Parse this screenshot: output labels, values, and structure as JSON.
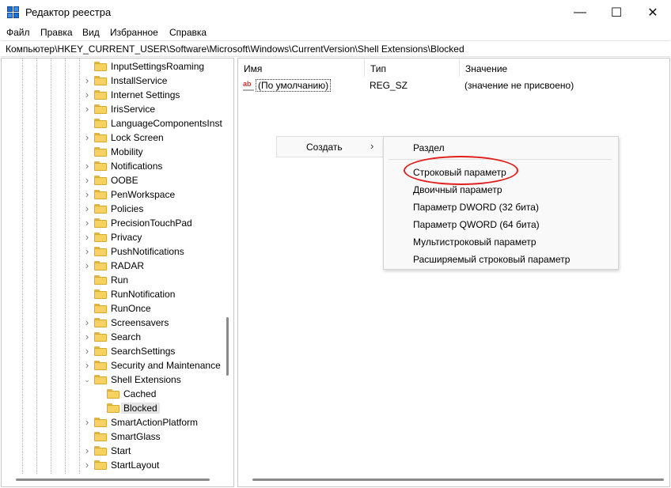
{
  "window": {
    "title": "Редактор реестра",
    "minimize_glyph": "—",
    "maximize_glyph": "☐",
    "close_glyph": "✕"
  },
  "menu": [
    "Файл",
    "Правка",
    "Вид",
    "Избранное",
    "Справка"
  ],
  "address": "Компьютер\\HKEY_CURRENT_USER\\Software\\Microsoft\\Windows\\CurrentVersion\\Shell Extensions\\Blocked",
  "tree": {
    "items": [
      {
        "label": "InputSettingsRoaming",
        "expander": "none",
        "level": 0
      },
      {
        "label": "InstallService",
        "expander": "collapsed",
        "level": 0
      },
      {
        "label": "Internet Settings",
        "expander": "collapsed",
        "level": 0
      },
      {
        "label": "IrisService",
        "expander": "collapsed",
        "level": 0
      },
      {
        "label": "LanguageComponentsInst",
        "expander": "none",
        "level": 0
      },
      {
        "label": "Lock Screen",
        "expander": "collapsed",
        "level": 0
      },
      {
        "label": "Mobility",
        "expander": "none",
        "level": 0
      },
      {
        "label": "Notifications",
        "expander": "collapsed",
        "level": 0
      },
      {
        "label": "OOBE",
        "expander": "collapsed",
        "level": 0
      },
      {
        "label": "PenWorkspace",
        "expander": "collapsed",
        "level": 0
      },
      {
        "label": "Policies",
        "expander": "collapsed",
        "level": 0
      },
      {
        "label": "PrecisionTouchPad",
        "expander": "collapsed",
        "level": 0
      },
      {
        "label": "Privacy",
        "expander": "collapsed",
        "level": 0
      },
      {
        "label": "PushNotifications",
        "expander": "collapsed",
        "level": 0
      },
      {
        "label": "RADAR",
        "expander": "collapsed",
        "level": 0
      },
      {
        "label": "Run",
        "expander": "none",
        "level": 0
      },
      {
        "label": "RunNotification",
        "expander": "none",
        "level": 0
      },
      {
        "label": "RunOnce",
        "expander": "none",
        "level": 0
      },
      {
        "label": "Screensavers",
        "expander": "collapsed",
        "level": 0
      },
      {
        "label": "Search",
        "expander": "collapsed",
        "level": 0
      },
      {
        "label": "SearchSettings",
        "expander": "collapsed",
        "level": 0
      },
      {
        "label": "Security and Maintenance",
        "expander": "collapsed",
        "level": 0
      },
      {
        "label": "Shell Extensions",
        "expander": "expanded",
        "level": 0
      },
      {
        "label": "Cached",
        "expander": "none",
        "level": 1
      },
      {
        "label": "Blocked",
        "expander": "none",
        "level": 1,
        "selected": true
      },
      {
        "label": "SmartActionPlatform",
        "expander": "collapsed",
        "level": 0
      },
      {
        "label": "SmartGlass",
        "expander": "none",
        "level": 0
      },
      {
        "label": "Start",
        "expander": "collapsed",
        "level": 0
      },
      {
        "label": "StartLayout",
        "expander": "collapsed",
        "level": 0
      }
    ]
  },
  "list": {
    "columns": [
      "Имя",
      "Тип",
      "Значение"
    ],
    "rows": [
      {
        "icon": "ab",
        "name": "(По умолчанию)",
        "type": "REG_SZ",
        "value": "(значение не присвоено)"
      }
    ]
  },
  "context_menu": {
    "create_label": "Создать",
    "arrow": "›",
    "submenu": [
      "Раздел",
      "Строковый параметр",
      "Двоичный параметр",
      "Параметр DWORD (32 бита)",
      "Параметр QWORD (64 бита)",
      "Мультистроковый параметр",
      "Расширяемый строковый параметр"
    ]
  },
  "colors": {
    "highlight_ellipse": "#e0201c",
    "folder": "#f8d165",
    "selection": "#e5e5e5"
  }
}
